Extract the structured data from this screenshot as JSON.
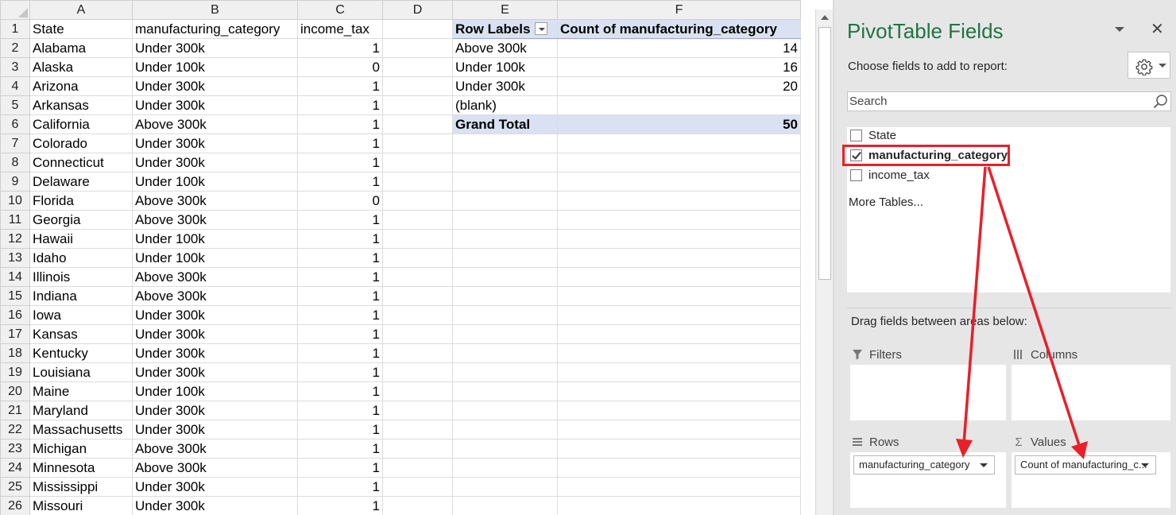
{
  "sheet": {
    "column_headers": [
      "A",
      "B",
      "C",
      "D",
      "E",
      "F"
    ],
    "rows": [
      {
        "n": "1",
        "a": "State",
        "b": "manufacturing_category",
        "c": "income_tax"
      },
      {
        "n": "2",
        "a": "Alabama",
        "b": "Under 300k",
        "c": "1"
      },
      {
        "n": "3",
        "a": "Alaska",
        "b": "Under 100k",
        "c": "0"
      },
      {
        "n": "4",
        "a": "Arizona",
        "b": "Under 300k",
        "c": "1"
      },
      {
        "n": "5",
        "a": "Arkansas",
        "b": "Under 300k",
        "c": "1"
      },
      {
        "n": "6",
        "a": "California",
        "b": "Above 300k",
        "c": "1"
      },
      {
        "n": "7",
        "a": "Colorado",
        "b": "Under 300k",
        "c": "1"
      },
      {
        "n": "8",
        "a": "Connecticut",
        "b": "Under 300k",
        "c": "1"
      },
      {
        "n": "9",
        "a": "Delaware",
        "b": "Under 100k",
        "c": "1"
      },
      {
        "n": "10",
        "a": "Florida",
        "b": "Above 300k",
        "c": "0"
      },
      {
        "n": "11",
        "a": "Georgia",
        "b": "Above 300k",
        "c": "1"
      },
      {
        "n": "12",
        "a": "Hawaii",
        "b": "Under 100k",
        "c": "1"
      },
      {
        "n": "13",
        "a": "Idaho",
        "b": "Under 100k",
        "c": "1"
      },
      {
        "n": "14",
        "a": "Illinois",
        "b": "Above 300k",
        "c": "1"
      },
      {
        "n": "15",
        "a": "Indiana",
        "b": "Above 300k",
        "c": "1"
      },
      {
        "n": "16",
        "a": "Iowa",
        "b": "Under 300k",
        "c": "1"
      },
      {
        "n": "17",
        "a": "Kansas",
        "b": "Under 300k",
        "c": "1"
      },
      {
        "n": "18",
        "a": "Kentucky",
        "b": "Under 300k",
        "c": "1"
      },
      {
        "n": "19",
        "a": "Louisiana",
        "b": "Under 300k",
        "c": "1"
      },
      {
        "n": "20",
        "a": "Maine",
        "b": "Under 100k",
        "c": "1"
      },
      {
        "n": "21",
        "a": "Maryland",
        "b": "Under 300k",
        "c": "1"
      },
      {
        "n": "22",
        "a": "Massachusetts",
        "b": "Under 300k",
        "c": "1"
      },
      {
        "n": "23",
        "a": "Michigan",
        "b": "Above 300k",
        "c": "1"
      },
      {
        "n": "24",
        "a": "Minnesota",
        "b": "Above 300k",
        "c": "1"
      },
      {
        "n": "25",
        "a": "Mississippi",
        "b": "Under 300k",
        "c": "1"
      },
      {
        "n": "26",
        "a": "Missouri",
        "b": "Under 300k",
        "c": "1"
      }
    ]
  },
  "pivot": {
    "header_row_labels": "Row Labels",
    "header_value": "Count of manufacturing_category",
    "rows": [
      {
        "label": "Above 300k",
        "value": "14"
      },
      {
        "label": "Under 100k",
        "value": "16"
      },
      {
        "label": "Under 300k",
        "value": "20"
      },
      {
        "label": "(blank)",
        "value": ""
      }
    ],
    "total_label": "Grand Total",
    "total_value": "50"
  },
  "pane": {
    "title": "PivotTable Fields",
    "close_glyph": "✕",
    "choose_label": "Choose fields to add to report:",
    "search_placeholder": "Search",
    "fields": [
      {
        "label": "State",
        "checked": false
      },
      {
        "label": "manufacturing_category",
        "checked": true
      },
      {
        "label": "income_tax",
        "checked": false
      }
    ],
    "more_tables": "More Tables...",
    "drag_label": "Drag fields between areas below:",
    "areas": {
      "filters": {
        "label": "Filters",
        "icon": "filter-icon",
        "chip": ""
      },
      "columns": {
        "label": "Columns",
        "icon": "columns-icon",
        "chip": ""
      },
      "rows": {
        "label": "Rows",
        "icon": "rows-icon",
        "chip": "manufacturing_category"
      },
      "values": {
        "label": "Values",
        "icon": "sigma-icon",
        "chip": "Count of manufacturing_c..."
      }
    }
  },
  "colors": {
    "accent_green": "#217346",
    "pivot_header_fill": "#d9e1f2",
    "annotation_red": "#e8202a"
  }
}
